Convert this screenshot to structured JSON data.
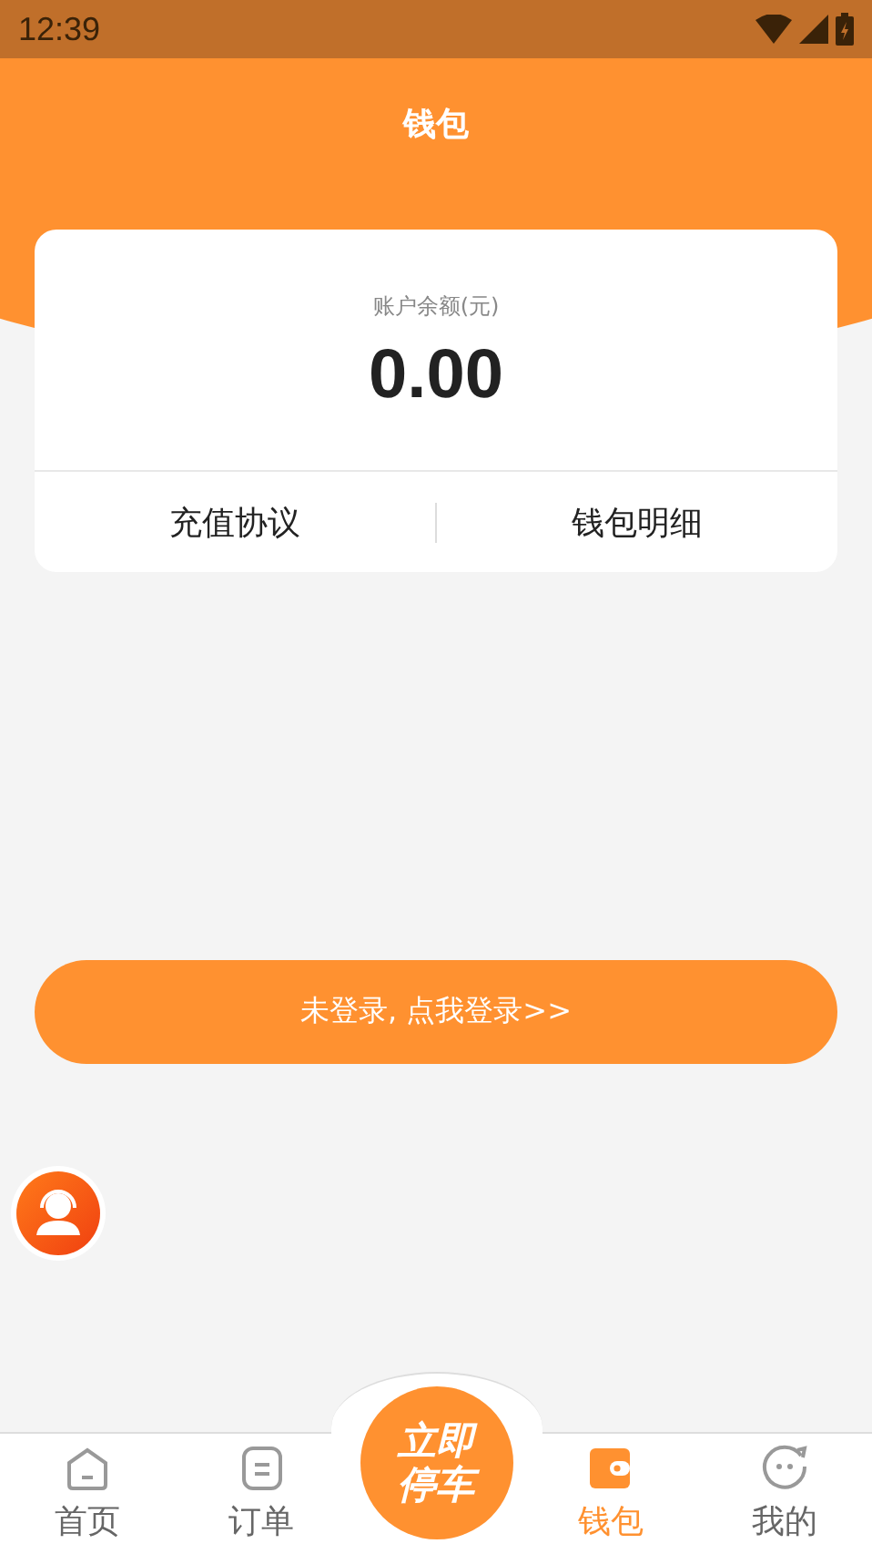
{
  "status_bar": {
    "time": "12:39"
  },
  "header": {
    "title": "钱包"
  },
  "balance": {
    "label": "账户余额(元)",
    "amount": "0.00"
  },
  "card_links": [
    "充值协议",
    "钱包明细"
  ],
  "login_button": "未登录, 点我登录>>",
  "center_action": {
    "label_lines": [
      "立即",
      "停车"
    ]
  },
  "tabs": [
    {
      "label": "首页",
      "kind": "home",
      "selected": false
    },
    {
      "label": "订单",
      "kind": "orders",
      "selected": false
    },
    {
      "label": "钱包",
      "kind": "wallet",
      "selected": true
    },
    {
      "label": "我的",
      "kind": "profile",
      "selected": false
    }
  ]
}
